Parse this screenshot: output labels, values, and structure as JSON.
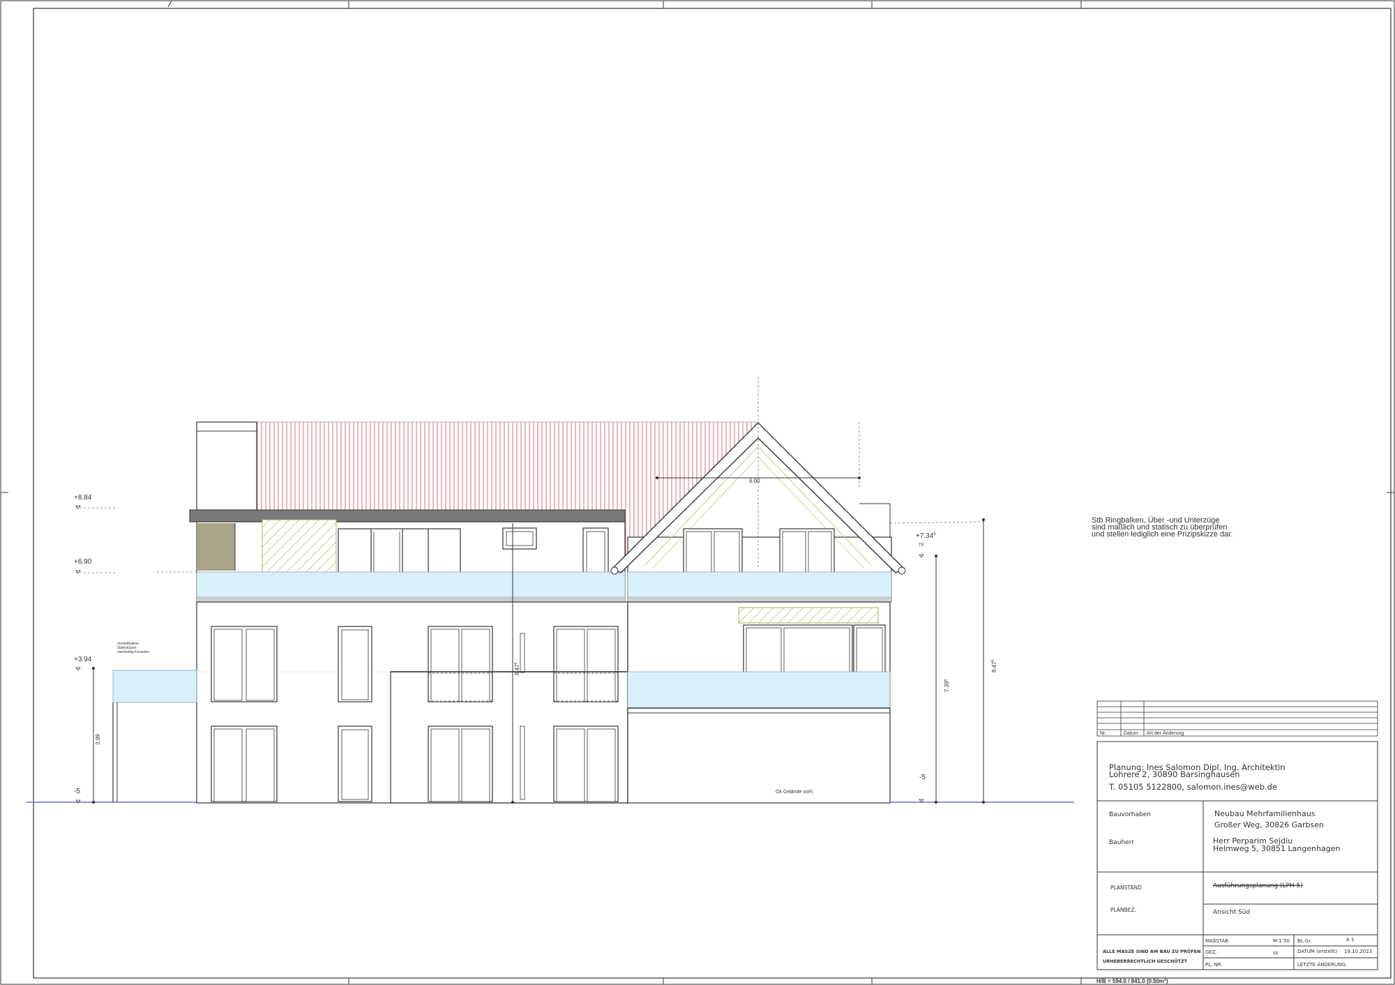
{
  "elevation_levels": {
    "l1": "+8.84",
    "l2": "+6.90",
    "l3": "+3.94",
    "l4": "-5",
    "right_top": "+7.34",
    "right_top_sup": "5",
    "right_tp": "TP",
    "right_bottom": "-5"
  },
  "dimensions": {
    "gable_width": "6.00",
    "left_height": "3.99",
    "center_height": "8.47",
    "center_height_sup": "5",
    "right_height1": "7.39",
    "right_height1_sup": "5",
    "right_height2": "8.47",
    "right_height2_sup": "5"
  },
  "notes": {
    "ringbalken_1": "Stb Ringbalken, Über -und Unterzüge",
    "ringbalken_2": "sind maßlich und statisch zu überprüfen",
    "ringbalken_3": "und stellen lediglich eine Prizipskizze dar.",
    "vordach_1": "Vorstellbalkon",
    "vordach_2": "Stahlstützen",
    "vordach_3": "wandseitig Konsolen",
    "terrain": "Ok Gelände vorh."
  },
  "revision_table": {
    "col_nr": "Nr.",
    "col_date": "Datum",
    "col_change": "Art der Änderung"
  },
  "architect": {
    "line1": "Planung: Ines Salomon Dipl. Ing. Architektin",
    "line2": "Lohrere 2, 30890  Barsinghausen",
    "line3": "T. 05105 5122800, salomon.ines@web.de"
  },
  "project": {
    "label_bauvorhaben": "Bauvorhaben",
    "bauvorhaben_1": "Neubau Mehrfamilienhaus",
    "bauvorhaben_2": "Großer Weg, 30826 Garbsen",
    "label_bauherr": "Bauherr",
    "bauherr_1": "Herr Perparim Sejdiu",
    "bauherr_2": "Helmweg 5, 30851 Langenhagen",
    "label_planstand": "PLANSTAND",
    "planstand": "Ausführungsplanung (LPH 5)",
    "label_planbez": "PLANBEZ.",
    "planbez": "Ansicht Süd"
  },
  "footer": {
    "note_1": "ALLE MASZE SIND AM BAU ZU PRÜFEN",
    "note_2": "URHEBERRECHTLICH GESCHÜTZT",
    "label_massstab": "MAßSTAB",
    "massstab": "M 1:50",
    "label_blgr": "BL.Gr.",
    "blgr": "A 1",
    "label_gez": "GEZ.",
    "gez": "ss",
    "label_datum": "DATUM (erstellt)",
    "datum": "19.10.2023",
    "label_plnr": "PL. NR.",
    "label_aenderung": "LETZTE ÄNDERUNG:",
    "sheet_size": "H/B = 594.0 / 841.0 (0.50m²)"
  },
  "colors": {
    "roof_hatch": "#d98a8a",
    "glass": "#d9f0fb",
    "olive_hatch": "#9bb55a",
    "slab": "#7a7a7a",
    "wall_fill": "#a9a48a",
    "ground_line": "#6f6fd0"
  }
}
